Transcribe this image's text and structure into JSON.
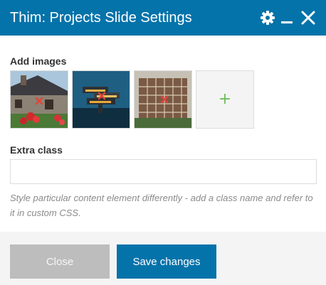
{
  "dialog": {
    "title": "Thim: Projects Slide Settings",
    "icons": [
      "gear-icon",
      "minimize-icon",
      "close-icon"
    ]
  },
  "images": {
    "label": "Add images",
    "thumbnails": [
      {
        "name": "stone-house-with-flowers"
      },
      {
        "name": "modern-stacked-building-at-dusk"
      },
      {
        "name": "building-under-construction"
      }
    ],
    "add_symbol": "+"
  },
  "extra_class": {
    "label": "Extra class",
    "value": "",
    "help": "Style particular content element differently - add a class name and refer to it in custom CSS."
  },
  "footer": {
    "close_label": "Close",
    "save_label": "Save changes"
  },
  "colors": {
    "header": "#0473aa",
    "remove_marker": "#e0443a",
    "add_plus": "#6cbf59",
    "close_button": "#bdbdbd"
  }
}
